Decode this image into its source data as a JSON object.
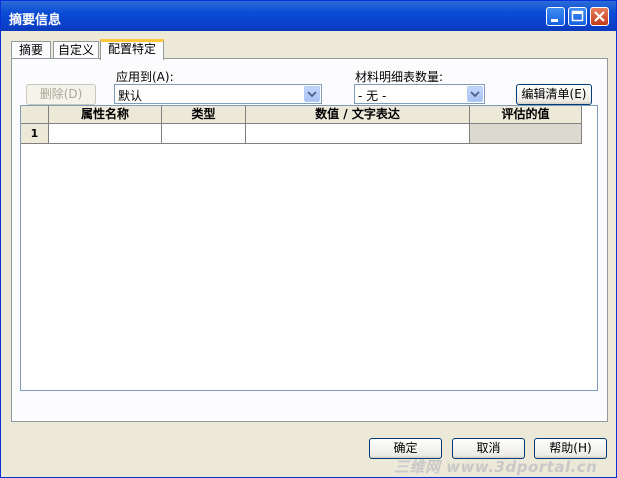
{
  "window": {
    "title": "摘要信息"
  },
  "tabs": [
    {
      "label": "摘要"
    },
    {
      "label": "自定义"
    },
    {
      "label": "配置特定"
    }
  ],
  "toolbar": {
    "delete_label": "删除(D)",
    "apply_to_label": "应用到(A):",
    "apply_to_value": "默认",
    "bom_qty_label": "材料明细表数量:",
    "bom_qty_value": "- 无 -",
    "edit_list_label": "编辑清单(E)"
  },
  "table": {
    "columns": [
      "属性名称",
      "类型",
      "数值 / 文字表达",
      "评估的值"
    ],
    "rows": [
      {
        "num": "1",
        "cells": [
          "",
          "",
          "",
          ""
        ]
      }
    ]
  },
  "footer": {
    "ok_label": "确定",
    "cancel_label": "取消",
    "help_label": "帮助(H)"
  },
  "watermark": "三维网 www.3dportal.cn",
  "colors": {
    "titlebar": "#0a4bd6",
    "dialog_bg": "#ece9d8",
    "active_tab_accent": "#ffc83c",
    "button_border": "#003c74",
    "close_button": "#c23b1a"
  }
}
